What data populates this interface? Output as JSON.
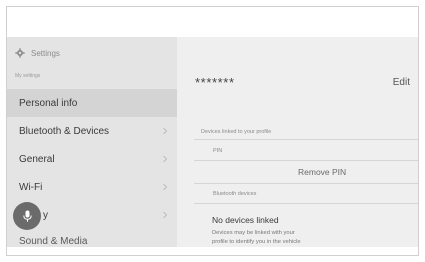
{
  "sidebar": {
    "header": {
      "title": "Settings",
      "icon": "gear-icon"
    },
    "section_label": "My settings",
    "items": [
      {
        "label": "Personal info",
        "active": true,
        "chevron": false
      },
      {
        "label": "Bluetooth & Devices",
        "active": false,
        "chevron": true
      },
      {
        "label": "General",
        "active": false,
        "chevron": true
      },
      {
        "label": "Wi-Fi",
        "active": false,
        "chevron": true
      },
      {
        "label": "y",
        "active": false,
        "chevron": true
      },
      {
        "label": "Sound & Media",
        "active": false,
        "chevron": false
      }
    ],
    "voice_button": {
      "icon": "microphone-icon"
    }
  },
  "main": {
    "profile_name": "*******",
    "edit_label": "Edit",
    "devices_linked_label": "Devices linked to your profile",
    "pin_label": "PIN",
    "remove_pin_label": "Remove PIN",
    "bluetooth_devices_label": "Bluetooth devices",
    "no_devices_label": "No devices linked",
    "hint_line1": "Devices may be linked with your",
    "hint_line2": "profile to identify you in the vehicle"
  },
  "colors": {
    "sidebar_bg": "#e4e4e4",
    "active_item_bg": "#d4d4d4",
    "main_bg": "#efefef",
    "mic_bg": "#6b6b6b"
  }
}
